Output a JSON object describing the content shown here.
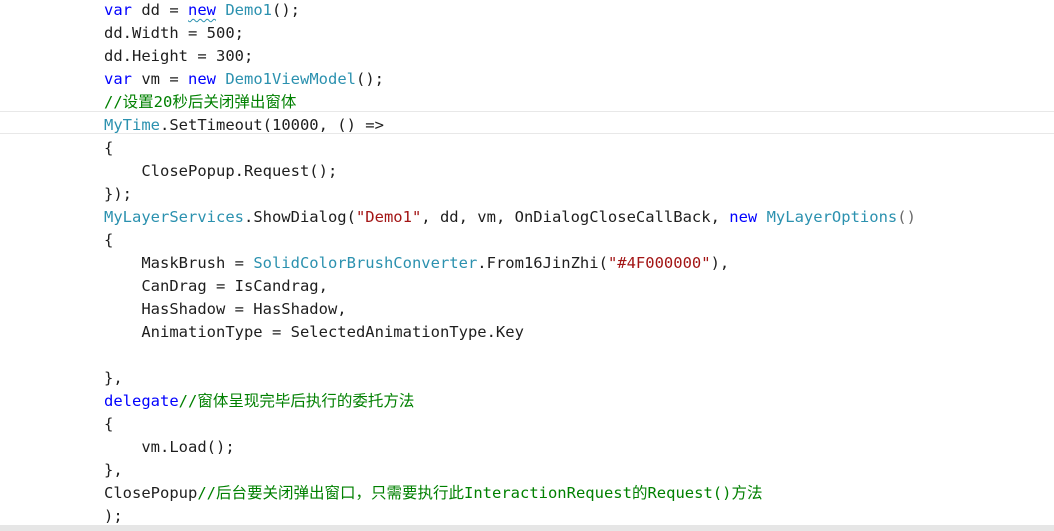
{
  "lines": [
    {
      "tokens": [
        {
          "t": "var",
          "c": "kw"
        },
        {
          "t": " dd = ",
          "c": "plain"
        },
        {
          "t": "new",
          "c": "kw"
        },
        {
          "t": " ",
          "c": "plain"
        },
        {
          "t": "Demo1",
          "c": "type"
        },
        {
          "t": "();",
          "c": "plain"
        }
      ]
    },
    {
      "tokens": [
        {
          "t": "dd.Width = 500;",
          "c": "plain"
        }
      ]
    },
    {
      "tokens": [
        {
          "t": "dd.Height = 300;",
          "c": "plain"
        }
      ]
    },
    {
      "tokens": [
        {
          "t": "var",
          "c": "kw"
        },
        {
          "t": " vm = ",
          "c": "plain"
        },
        {
          "t": "new",
          "c": "kw"
        },
        {
          "t": " ",
          "c": "plain"
        },
        {
          "t": "Demo1ViewModel",
          "c": "type"
        },
        {
          "t": "();",
          "c": "plain"
        }
      ]
    },
    {
      "tokens": [
        {
          "t": "//设置20秒后关闭弹出窗体",
          "c": "cm"
        }
      ]
    },
    {
      "tokens": [
        {
          "t": "MyTime",
          "c": "type"
        },
        {
          "t": ".SetTimeout(10000, () =>",
          "c": "plain"
        }
      ]
    },
    {
      "tokens": [
        {
          "t": "{",
          "c": "plain"
        }
      ]
    },
    {
      "tokens": [
        {
          "t": "    ClosePopup.Request();",
          "c": "plain"
        }
      ]
    },
    {
      "tokens": [
        {
          "t": "});",
          "c": "plain"
        }
      ]
    },
    {
      "tokens": [
        {
          "t": "MyLayerServices",
          "c": "type"
        },
        {
          "t": ".ShowDialog(",
          "c": "plain"
        },
        {
          "t": "\"Demo1\"",
          "c": "str"
        },
        {
          "t": ", dd, vm, OnDialogCloseCallBack, ",
          "c": "plain"
        },
        {
          "t": "new",
          "c": "kw"
        },
        {
          "t": " ",
          "c": "plain"
        },
        {
          "t": "MyLayerOptions",
          "c": "type"
        },
        {
          "t": "()",
          "c": "punc"
        }
      ]
    },
    {
      "tokens": [
        {
          "t": "{",
          "c": "plain"
        }
      ]
    },
    {
      "tokens": [
        {
          "t": "    MaskBrush = ",
          "c": "plain"
        },
        {
          "t": "SolidColorBrushConverter",
          "c": "type"
        },
        {
          "t": ".From16JinZhi(",
          "c": "plain"
        },
        {
          "t": "\"#4F000000\"",
          "c": "str"
        },
        {
          "t": "),",
          "c": "plain"
        }
      ]
    },
    {
      "tokens": [
        {
          "t": "    CanDrag = IsCandrag,",
          "c": "plain"
        }
      ]
    },
    {
      "tokens": [
        {
          "t": "    HasShadow = HasShadow,",
          "c": "plain"
        }
      ]
    },
    {
      "tokens": [
        {
          "t": "    AnimationType = SelectedAnimationType.Key",
          "c": "plain"
        }
      ]
    },
    {
      "tokens": [
        {
          "t": "",
          "c": "plain"
        }
      ]
    },
    {
      "tokens": [
        {
          "t": "},",
          "c": "plain"
        }
      ]
    },
    {
      "tokens": [
        {
          "t": "delegate",
          "c": "kw"
        },
        {
          "t": "//窗体呈现完毕后执行的委托方法",
          "c": "cm"
        }
      ]
    },
    {
      "tokens": [
        {
          "t": "{",
          "c": "plain"
        }
      ]
    },
    {
      "tokens": [
        {
          "t": "    vm.Load();",
          "c": "plain"
        }
      ]
    },
    {
      "tokens": [
        {
          "t": "},",
          "c": "plain"
        }
      ]
    },
    {
      "tokens": [
        {
          "t": "ClosePopup",
          "c": "plain"
        },
        {
          "t": "//后台要关闭弹出窗口，只需要执行此InteractionRequest的Request()方法",
          "c": "cm"
        }
      ]
    },
    {
      "tokens": [
        {
          "t": ");",
          "c": "plain"
        }
      ]
    }
  ],
  "colors": {
    "keyword": "#0000ff",
    "type": "#2b91af",
    "string": "#a31515",
    "comment": "#008000",
    "text": "#1e1e1e"
  }
}
